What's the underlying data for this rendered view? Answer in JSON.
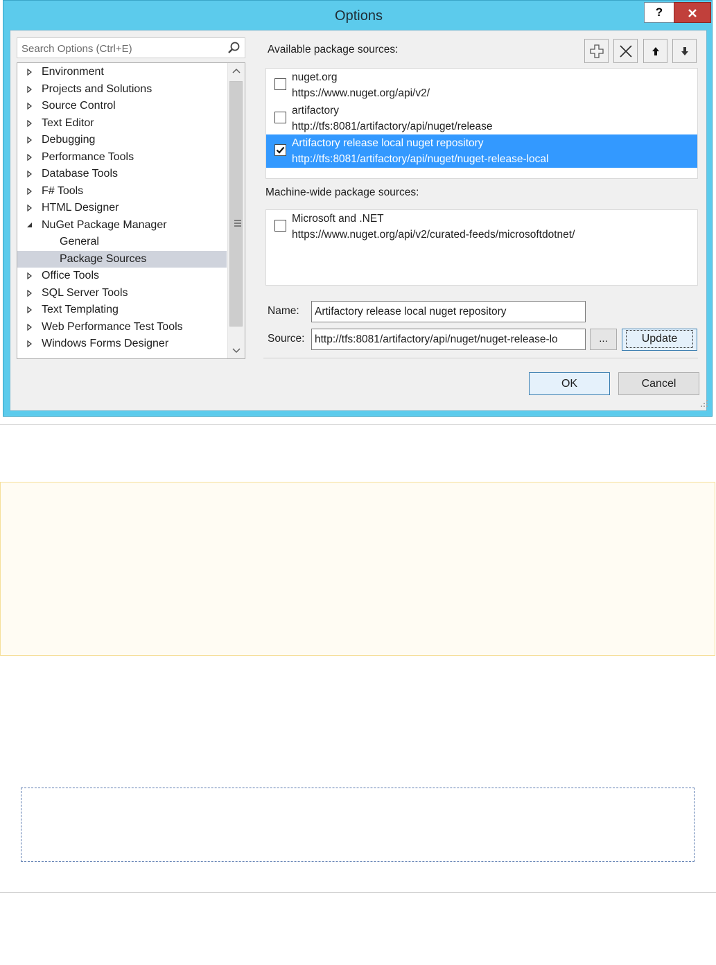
{
  "window": {
    "title": "Options",
    "help_label": "?",
    "close_label": "x",
    "colors": {
      "titlebar": "#5ccbec",
      "selection": "#3399ff",
      "tree_selection": "#cfd3dc",
      "close": "#c1403b"
    }
  },
  "search": {
    "placeholder": "Search Options (Ctrl+E)",
    "icon": "search-icon"
  },
  "tree": {
    "items": [
      {
        "label": "Environment",
        "expander": "collapsed"
      },
      {
        "label": "Projects and Solutions",
        "expander": "collapsed"
      },
      {
        "label": "Source Control",
        "expander": "collapsed"
      },
      {
        "label": "Text Editor",
        "expander": "collapsed"
      },
      {
        "label": "Debugging",
        "expander": "collapsed"
      },
      {
        "label": "Performance Tools",
        "expander": "collapsed"
      },
      {
        "label": "Database Tools",
        "expander": "collapsed"
      },
      {
        "label": "F# Tools",
        "expander": "collapsed"
      },
      {
        "label": "HTML Designer",
        "expander": "collapsed"
      },
      {
        "label": "NuGet Package Manager",
        "expander": "expanded"
      },
      {
        "label": "General",
        "expander": "none"
      },
      {
        "label": "Package Sources",
        "expander": "none",
        "selected": true
      },
      {
        "label": "Office Tools",
        "expander": "collapsed"
      },
      {
        "label": "SQL Server Tools",
        "expander": "collapsed"
      },
      {
        "label": "Text Templating",
        "expander": "collapsed"
      },
      {
        "label": "Web Performance Test Tools",
        "expander": "collapsed"
      },
      {
        "label": "Windows Forms Designer",
        "expander": "collapsed"
      }
    ]
  },
  "available": {
    "label": "Available package sources:",
    "sources": [
      {
        "name": "nuget.org",
        "url": "https://www.nuget.org/api/v2/",
        "checked": false,
        "selected": false
      },
      {
        "name": "artifactory",
        "url": "http://tfs:8081/artifactory/api/nuget/release",
        "checked": false,
        "selected": false
      },
      {
        "name": "Artifactory release local nuget repository",
        "url": "http://tfs:8081/artifactory/api/nuget/nuget-release-local",
        "checked": true,
        "selected": true
      }
    ],
    "toolbar": [
      "add-icon",
      "remove-icon",
      "arrow-up-icon",
      "arrow-down-icon"
    ]
  },
  "machine": {
    "label": "Machine-wide package sources:",
    "sources": [
      {
        "name": "Microsoft and .NET",
        "url": "https://www.nuget.org/api/v2/curated-feeds/microsoftdotnet/",
        "checked": false
      }
    ]
  },
  "form": {
    "name_label": "Name:",
    "name_value": "Artifactory release local nuget repository",
    "source_label": "Source:",
    "source_value": "http://tfs:8081/artifactory/api/nuget/nuget-release-lo",
    "browse_label": "...",
    "update_label": "Update"
  },
  "buttons": {
    "ok": "OK",
    "cancel": "Cancel"
  }
}
